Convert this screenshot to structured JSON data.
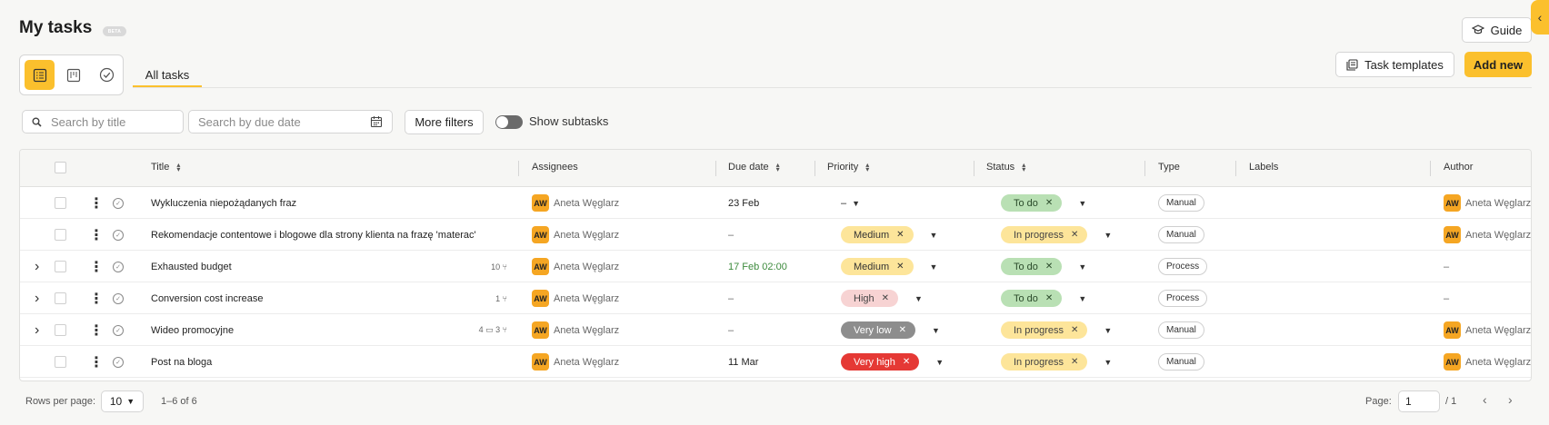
{
  "page": {
    "title": "My tasks",
    "badge": "BETA"
  },
  "header": {
    "guide_label": "Guide",
    "collapse_glyph": "‹"
  },
  "tabs": [
    {
      "label": "All tasks",
      "active": true
    }
  ],
  "actions": {
    "task_templates_label": "Task templates",
    "add_new_label": "Add new"
  },
  "filters": {
    "search_title_placeholder": "Search by title",
    "search_date_placeholder": "Search by due date",
    "more_filters_label": "More filters",
    "show_subtasks_label": "Show subtasks"
  },
  "table": {
    "columns": {
      "title": "Title",
      "assignees": "Assignees",
      "due_date": "Due date",
      "priority": "Priority",
      "status": "Status",
      "type": "Type",
      "labels": "Labels",
      "author": "Author"
    },
    "rows": [
      {
        "title": "Wykluczenia niepożądanych fraz",
        "expandable": false,
        "meta": "",
        "assignee_initials": "AW",
        "assignee": "Aneta Węglarz",
        "due": "23 Feb",
        "due_style": "normal",
        "priority": "–",
        "status": "To do",
        "type": "Manual",
        "author_initials": "AW",
        "author": "Aneta Węglarz"
      },
      {
        "title": "Rekomendacje contentowe i blogowe dla strony klienta na frazę 'materac'",
        "expandable": false,
        "meta": "",
        "assignee_initials": "AW",
        "assignee": "Aneta Węglarz",
        "due": "–",
        "due_style": "muted",
        "priority": "Medium",
        "status": "In progress",
        "type": "Manual",
        "author_initials": "AW",
        "author": "Aneta Węglarz"
      },
      {
        "title": "Exhausted budget",
        "expandable": true,
        "meta": "10 ⑂",
        "assignee_initials": "AW",
        "assignee": "Aneta Węglarz",
        "due": "17 Feb 02:00",
        "due_style": "green",
        "priority": "Medium",
        "status": "To do",
        "type": "Process",
        "author_initials": "",
        "author": "–"
      },
      {
        "title": "Conversion cost increase",
        "expandable": true,
        "meta": "1 ⑂",
        "assignee_initials": "AW",
        "assignee": "Aneta Węglarz",
        "due": "–",
        "due_style": "muted",
        "priority": "High",
        "status": "To do",
        "type": "Process",
        "author_initials": "",
        "author": "–"
      },
      {
        "title": "Wideo promocyjne",
        "expandable": true,
        "meta": "4 ▭ 3 ⑂",
        "assignee_initials": "AW",
        "assignee": "Aneta Węglarz",
        "due": "–",
        "due_style": "muted",
        "priority": "Very low",
        "status": "In progress",
        "type": "Manual",
        "author_initials": "AW",
        "author": "Aneta Węglarz"
      },
      {
        "title": "Post na bloga",
        "expandable": false,
        "meta": "",
        "assignee_initials": "AW",
        "assignee": "Aneta Węglarz",
        "due": "11 Mar",
        "due_style": "normal",
        "priority": "Very high",
        "status": "In progress",
        "type": "Manual",
        "author_initials": "AW",
        "author": "Aneta Węglarz"
      }
    ]
  },
  "footer": {
    "rows_per_page_label": "Rows per page:",
    "rows_per_page_value": "10",
    "range": "1–6 of 6",
    "page_label": "Page:",
    "page_value": "1",
    "page_total": "/ 1"
  },
  "colors": {
    "accent": "#fbc02d",
    "todo": "#b9e0b4",
    "in_progress": "#fde59a",
    "very_high": "#e53935",
    "very_low": "#8d8d8d",
    "high": "#f7d3d3"
  }
}
